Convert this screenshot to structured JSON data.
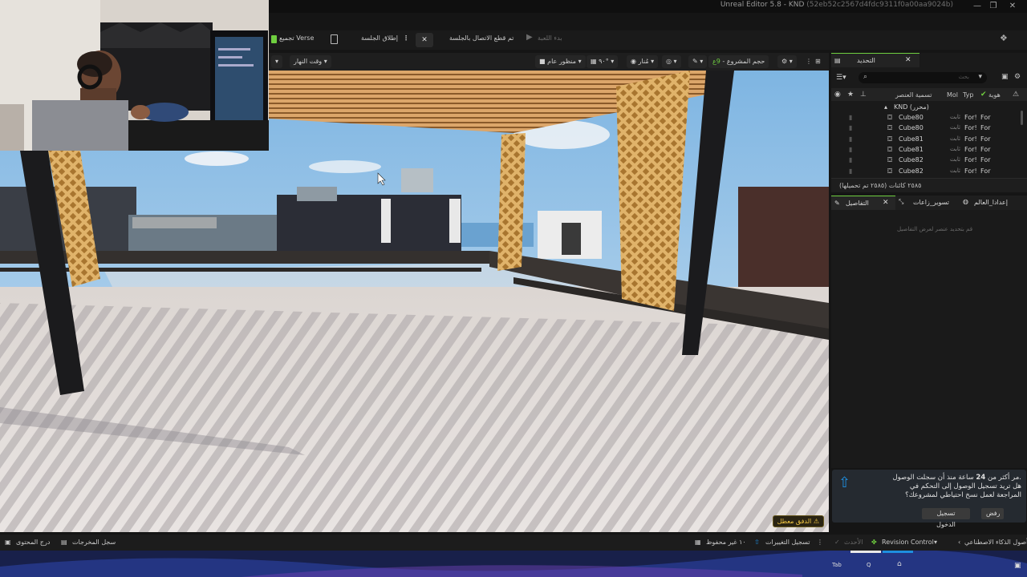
{
  "titlebar": {
    "app_title": "Unreal Editor 5.8 - KND",
    "hash": "(52eb52c2567d4fdc9311f0a00aa9024b)",
    "minimize": "—",
    "maximize": "❐",
    "close": "✕"
  },
  "toolbar": {
    "verse_label": "تجميع Verse",
    "session_label": "إطلاق الجلسة",
    "disconnect_label": "تم قطع الاتصال بالجلسة",
    "start_game_label": "بدء اللعبة"
  },
  "viewport_toolbar": {
    "time_of_day": "وقت النهار",
    "perspective": "منظور عام",
    "fov": "٩٠°",
    "lit": "مُنار",
    "project_size_label": "حجم المشروع",
    "project_size_value": "9ع"
  },
  "viewport": {
    "performance_warning": "الدفق معطل"
  },
  "outliner": {
    "tab_title": "التحديد",
    "search_placeholder": "بحث",
    "col_name": "تسمية العنصر",
    "col_mob": "Mol",
    "col_type": "Typ",
    "col_identity": "هوية",
    "root_label": "KND (محرر)",
    "rows": [
      {
        "name": "Cube80",
        "state": "ثابت",
        "c1": "For!",
        "c2": "For"
      },
      {
        "name": "Cube80",
        "state": "ثابت",
        "c1": "For!",
        "c2": "For"
      },
      {
        "name": "Cube81",
        "state": "ثابت",
        "c1": "For!",
        "c2": "For"
      },
      {
        "name": "Cube81",
        "state": "ثابت",
        "c1": "For!",
        "c2": "For"
      },
      {
        "name": "Cube82",
        "state": "ثابت",
        "c1": "For!",
        "c2": "For"
      },
      {
        "name": "Cube82",
        "state": "ثابت",
        "c1": "For!",
        "c2": "For"
      }
    ],
    "footer": "٢٥٨٥ كائنات (٢٥٨٥ تم تحميلها)"
  },
  "details": {
    "tab_details": "التفاصيل",
    "tab_assets": "تسوير_زاعات",
    "tab_world": "إعدادا_العالم",
    "empty_message": "قم بتحديد عنصر لعرض التفاصيل"
  },
  "notification": {
    "line1_pre": "مر أكثر من ",
    "line1_num": "24",
    "line1_post": " ساعة منذ أن سجلت الوصول.",
    "line2": "هل تريد تسجيل الوصول إلى التحكم في",
    "line3": "المراجعة لعمل نسخ احتياطي لمشروعك؟",
    "login_button": "تسجيل الدخول",
    "reject_button": "رفض"
  },
  "bottombar": {
    "content_drawer": "درج المحتوى",
    "output_log": "سجل المخرجات",
    "unsaved": "١٠ غير محفوظ",
    "changes": "تسجيل التغييرات",
    "latest": "الأحدث",
    "revision_control": "Revision Control",
    "ai_assets": "أصول الذكاء الاصطناعي"
  },
  "taskbar": {
    "tab_key": "Tab",
    "q_key": "Q"
  },
  "colors": {
    "accent_green": "#6fcf3f",
    "accent_blue": "#1e8fe0",
    "warning_yellow": "#f2c744",
    "panel_bg": "#1a1a1a"
  }
}
